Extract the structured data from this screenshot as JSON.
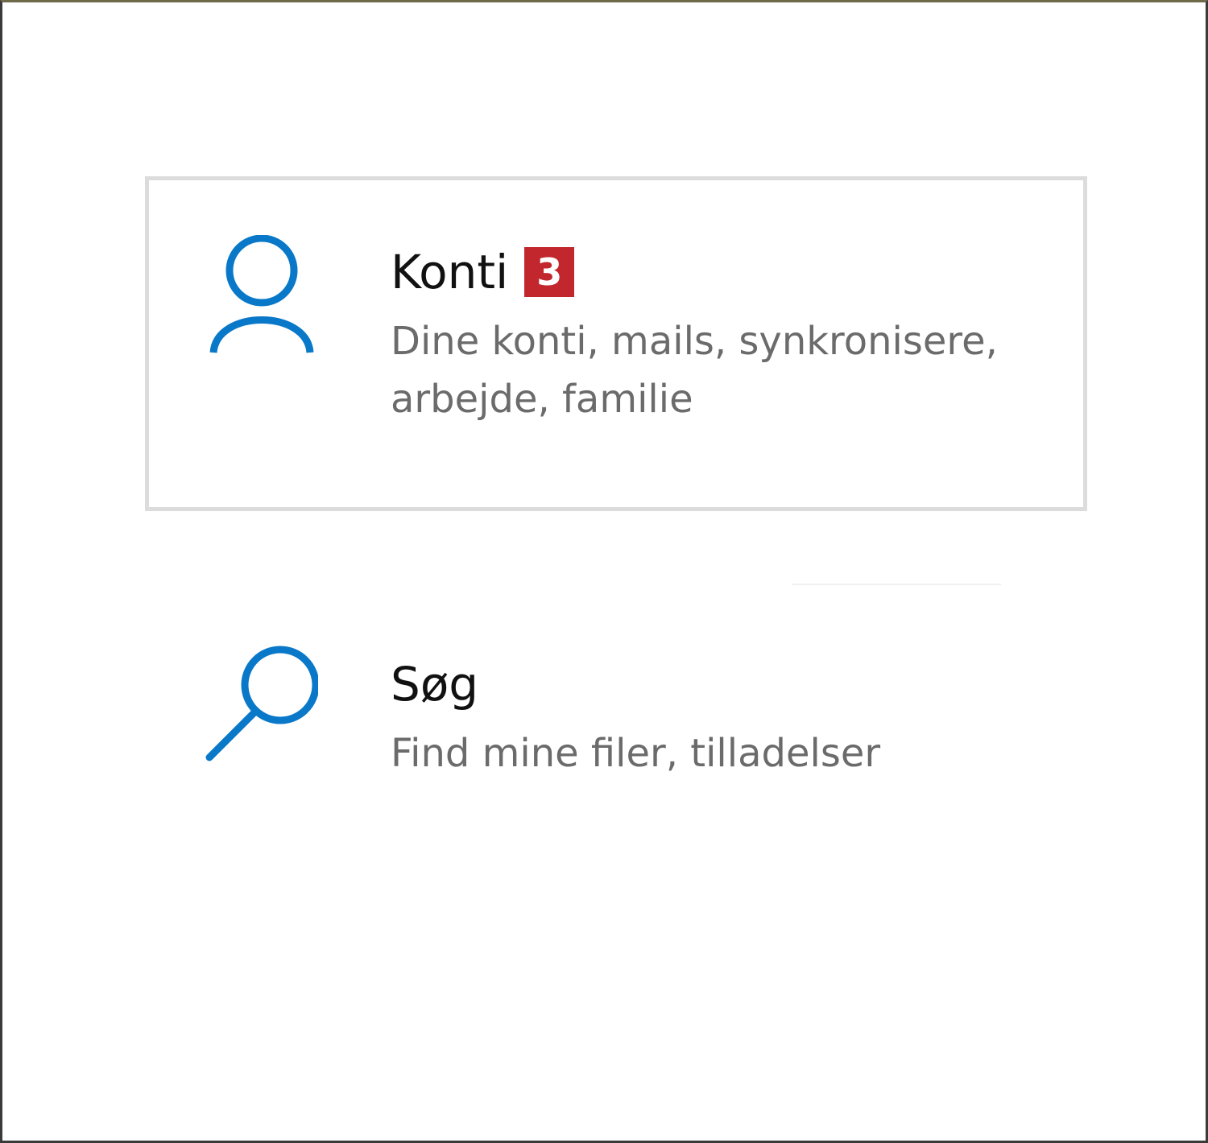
{
  "accent_color": "#0a78c8",
  "badge_color": "#c1272d",
  "tiles": [
    {
      "icon": "person-icon",
      "title": "Konti",
      "badge": "3",
      "description_line1": "Dine konti, mails, synkronisere,",
      "description_line2": "arbejde, familie",
      "selected": true
    },
    {
      "icon": "search-icon",
      "title": "Søg",
      "description_line1": "Find mine filer, tilladelser",
      "selected": false
    }
  ]
}
